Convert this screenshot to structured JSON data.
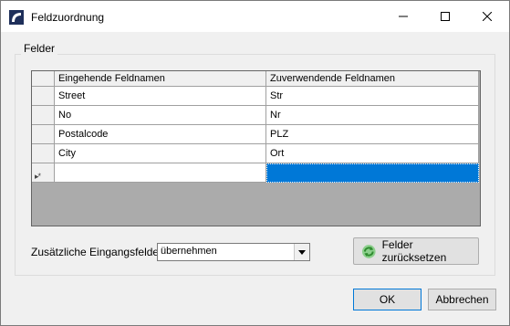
{
  "window": {
    "title": "Feldzuordnung",
    "controls": [
      "minimize",
      "maximize",
      "close"
    ]
  },
  "group": {
    "label": "Felder"
  },
  "grid": {
    "columns": [
      "Eingehende Feldnamen",
      "Zuverwendende Feldnamen"
    ],
    "rows": [
      {
        "incoming": "Street",
        "target": "Str"
      },
      {
        "incoming": "No",
        "target": "Nr"
      },
      {
        "incoming": "Postalcode",
        "target": "PLZ"
      },
      {
        "incoming": "City",
        "target": "Ort"
      }
    ],
    "new_row_marker": "▸*"
  },
  "extra_fields": {
    "label": "Zusätzliche Eingangsfelder",
    "selected": "übernehmen"
  },
  "buttons": {
    "reset": "Felder zurücksetzen",
    "ok": "OK",
    "cancel": "Abbrechen"
  },
  "colors": {
    "selection": "#0078d7",
    "grid_background": "#ababab"
  }
}
